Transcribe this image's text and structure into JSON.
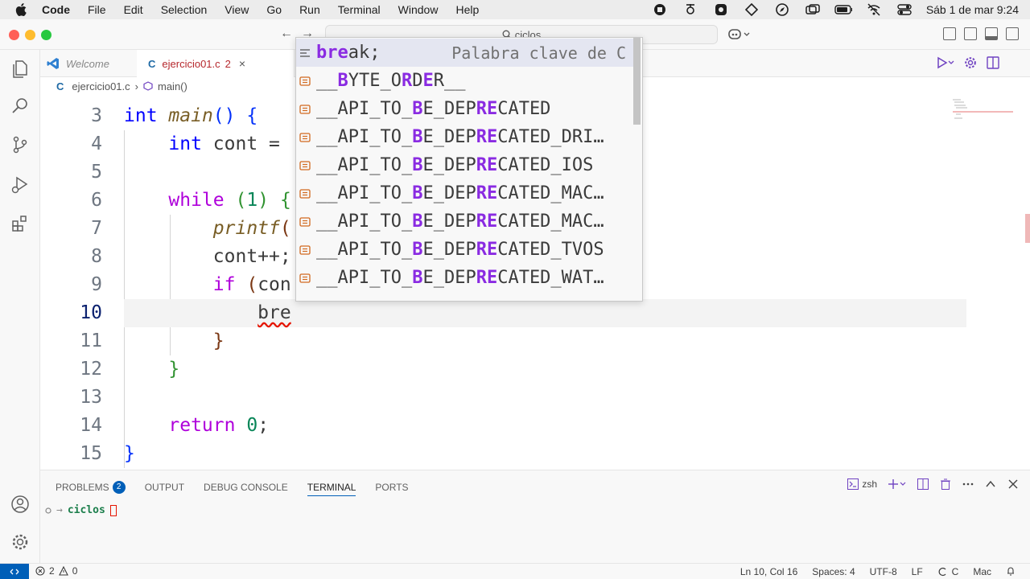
{
  "menubar": {
    "app_name": "Code",
    "items": [
      "File",
      "Edit",
      "Selection",
      "View",
      "Go",
      "Run",
      "Terminal",
      "Window",
      "Help"
    ],
    "clock": "Sáb 1 de mar  9:24"
  },
  "titlebar": {
    "search_text": "ciclos"
  },
  "tabs": {
    "welcome": "Welcome",
    "active_file": "ejercicio01.c",
    "active_problems": "2",
    "close": "×",
    "c_logo": "C"
  },
  "breadcrumb": {
    "file": "ejercicio01.c",
    "symbol": "main()",
    "c_logo": "C"
  },
  "editor": {
    "lines": [
      {
        "n": "3",
        "tokens": [
          [
            "kw",
            "int"
          ],
          [
            "t",
            " "
          ],
          [
            "fn",
            "main"
          ],
          [
            "br1",
            "()"
          ],
          [
            "t",
            " "
          ],
          [
            "br1",
            "{"
          ]
        ]
      },
      {
        "n": "4",
        "tokens": [
          [
            "t",
            "    "
          ],
          [
            "kw",
            "int"
          ],
          [
            "t",
            " cont = "
          ]
        ]
      },
      {
        "n": "5",
        "tokens": []
      },
      {
        "n": "6",
        "tokens": [
          [
            "t",
            "    "
          ],
          [
            "kw-ctrl",
            "while"
          ],
          [
            "t",
            " "
          ],
          [
            "br2",
            "("
          ],
          [
            "num",
            "1"
          ],
          [
            "br2",
            ")"
          ],
          [
            "t",
            " "
          ],
          [
            "br2",
            "{"
          ]
        ]
      },
      {
        "n": "7",
        "tokens": [
          [
            "t",
            "        "
          ],
          [
            "fn-call",
            "printf"
          ],
          [
            "br3",
            "("
          ]
        ]
      },
      {
        "n": "8",
        "tokens": [
          [
            "t",
            "        cont++;"
          ]
        ]
      },
      {
        "n": "9",
        "tokens": [
          [
            "t",
            "        "
          ],
          [
            "kw-ctrl",
            "if"
          ],
          [
            "t",
            " "
          ],
          [
            "br3",
            "("
          ],
          [
            "t",
            "con"
          ]
        ]
      },
      {
        "n": "10",
        "tokens": [
          [
            "t",
            "            "
          ],
          [
            "sq",
            "bre"
          ]
        ]
      },
      {
        "n": "11",
        "tokens": [
          [
            "t",
            "        "
          ],
          [
            "br3",
            "}"
          ]
        ]
      },
      {
        "n": "12",
        "tokens": [
          [
            "t",
            "    "
          ],
          [
            "br2",
            "}"
          ]
        ]
      },
      {
        "n": "13",
        "tokens": []
      },
      {
        "n": "14",
        "tokens": [
          [
            "t",
            "    "
          ],
          [
            "kw-ctrl",
            "return"
          ],
          [
            "t",
            " "
          ],
          [
            "num",
            "0"
          ],
          [
            "t",
            ";"
          ]
        ]
      },
      {
        "n": "15",
        "tokens": [
          [
            "br1",
            "}"
          ]
        ]
      }
    ],
    "current_line": "10"
  },
  "suggest": {
    "items": [
      {
        "parts": [
          [
            "hl",
            "bre"
          ],
          [
            "t",
            "ak;"
          ]
        ],
        "detail": "Palabra clave de C",
        "kind": "keyword-snippet"
      },
      {
        "parts": [
          [
            "t",
            "__"
          ],
          [
            "hl",
            "B"
          ],
          [
            "t",
            "YTE_O"
          ],
          [
            "hl",
            "R"
          ],
          [
            "t",
            "D"
          ],
          [
            "hl",
            "E"
          ],
          [
            "t",
            "R__"
          ]
        ],
        "detail": "",
        "kind": "constant"
      },
      {
        "parts": [
          [
            "t",
            "__API_TO_"
          ],
          [
            "hl",
            "B"
          ],
          [
            "t",
            "E_DEP"
          ],
          [
            "hl",
            "RE"
          ],
          [
            "t",
            "CATED"
          ]
        ],
        "detail": "",
        "kind": "constant"
      },
      {
        "parts": [
          [
            "t",
            "__API_TO_"
          ],
          [
            "hl",
            "B"
          ],
          [
            "t",
            "E_DEP"
          ],
          [
            "hl",
            "RE"
          ],
          [
            "t",
            "CATED_DRI…"
          ]
        ],
        "detail": "",
        "kind": "constant"
      },
      {
        "parts": [
          [
            "t",
            "__API_TO_"
          ],
          [
            "hl",
            "B"
          ],
          [
            "t",
            "E_DEP"
          ],
          [
            "hl",
            "RE"
          ],
          [
            "t",
            "CATED_IOS"
          ]
        ],
        "detail": "",
        "kind": "constant"
      },
      {
        "parts": [
          [
            "t",
            "__API_TO_"
          ],
          [
            "hl",
            "B"
          ],
          [
            "t",
            "E_DEP"
          ],
          [
            "hl",
            "RE"
          ],
          [
            "t",
            "CATED_MAC…"
          ]
        ],
        "detail": "",
        "kind": "constant"
      },
      {
        "parts": [
          [
            "t",
            "__API_TO_"
          ],
          [
            "hl",
            "B"
          ],
          [
            "t",
            "E_DEP"
          ],
          [
            "hl",
            "RE"
          ],
          [
            "t",
            "CATED_MAC…"
          ]
        ],
        "detail": "",
        "kind": "constant"
      },
      {
        "parts": [
          [
            "t",
            "__API_TO_"
          ],
          [
            "hl",
            "B"
          ],
          [
            "t",
            "E_DEP"
          ],
          [
            "hl",
            "RE"
          ],
          [
            "t",
            "CATED_TVOS"
          ]
        ],
        "detail": "",
        "kind": "constant"
      },
      {
        "parts": [
          [
            "t",
            "__API_TO_"
          ],
          [
            "hl",
            "B"
          ],
          [
            "t",
            "E_DEP"
          ],
          [
            "hl",
            "RE"
          ],
          [
            "t",
            "CATED_WAT…"
          ]
        ],
        "detail": "",
        "kind": "constant"
      }
    ]
  },
  "panel": {
    "tabs": [
      {
        "label": "PROBLEMS",
        "badge": "2",
        "active": false
      },
      {
        "label": "OUTPUT",
        "badge": "",
        "active": false
      },
      {
        "label": "DEBUG CONSOLE",
        "badge": "",
        "active": false
      },
      {
        "label": "TERMINAL",
        "badge": "",
        "active": true
      },
      {
        "label": "PORTS",
        "badge": "",
        "active": false
      }
    ],
    "shell": "zsh",
    "prompt_arrow": "→",
    "prompt_dir": "ciclos"
  },
  "statusbar": {
    "errors": "2",
    "warnings": "0",
    "position": "Ln 10, Col 16",
    "spaces": "Spaces: 4",
    "encoding": "UTF-8",
    "eol": "LF",
    "language": "C",
    "platform": "Mac"
  },
  "colors": {
    "accent": "#005fb8",
    "error": "#e51400",
    "suggest_highlight": "#8a2be2"
  }
}
